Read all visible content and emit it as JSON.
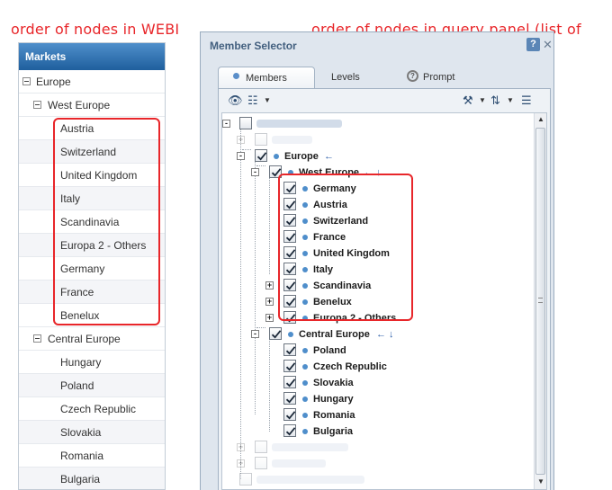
{
  "annotations": {
    "left": "order of nodes in WEBI",
    "right": "order of nodes in query panel (list of values)"
  },
  "webi": {
    "header": "Markets",
    "items": [
      {
        "label": "Europe",
        "level": 0,
        "expander": true
      },
      {
        "label": "West Europe",
        "level": 1,
        "expander": true
      },
      {
        "label": "Austria",
        "level": 2
      },
      {
        "label": "Switzerland",
        "level": 2
      },
      {
        "label": "United Kingdom",
        "level": 2
      },
      {
        "label": "Italy",
        "level": 2
      },
      {
        "label": "Scandinavia",
        "level": 2
      },
      {
        "label": "Europa 2 - Others",
        "level": 2
      },
      {
        "label": "Germany",
        "level": 2
      },
      {
        "label": "France",
        "level": 2
      },
      {
        "label": "Benelux",
        "level": 2
      },
      {
        "label": "Central Europe",
        "level": 1,
        "expander": true
      },
      {
        "label": "Hungary",
        "level": 2
      },
      {
        "label": "Poland",
        "level": 2
      },
      {
        "label": "Czech Republic",
        "level": 2
      },
      {
        "label": "Slovakia",
        "level": 2
      },
      {
        "label": "Romania",
        "level": 2
      },
      {
        "label": "Bulgaria",
        "level": 2
      }
    ]
  },
  "dialog": {
    "title": "Member Selector",
    "help": "?",
    "close": "✕",
    "tabs": {
      "members": "Members",
      "levels": "Levels",
      "prompt": "Prompt"
    },
    "tree": {
      "europe": "Europe",
      "west_europe": "West Europe",
      "west_children": [
        {
          "label": "Germany",
          "expander": false
        },
        {
          "label": "Austria",
          "expander": false
        },
        {
          "label": "Switzerland",
          "expander": false
        },
        {
          "label": "France",
          "expander": false
        },
        {
          "label": "United Kingdom",
          "expander": false
        },
        {
          "label": "Italy",
          "expander": false
        },
        {
          "label": "Scandinavia",
          "expander": true
        },
        {
          "label": "Benelux",
          "expander": true
        },
        {
          "label": "Europa 2 - Others",
          "expander": true
        }
      ],
      "central_europe": "Central Europe",
      "central_children": [
        "Poland",
        "Czech Republic",
        "Slovakia",
        "Hungary",
        "Romania",
        "Bulgaria"
      ]
    }
  },
  "colors": {
    "annotation_red": "#e8262a",
    "header_blue": "#1f5f9d",
    "dot_blue": "#4f8ecb"
  }
}
